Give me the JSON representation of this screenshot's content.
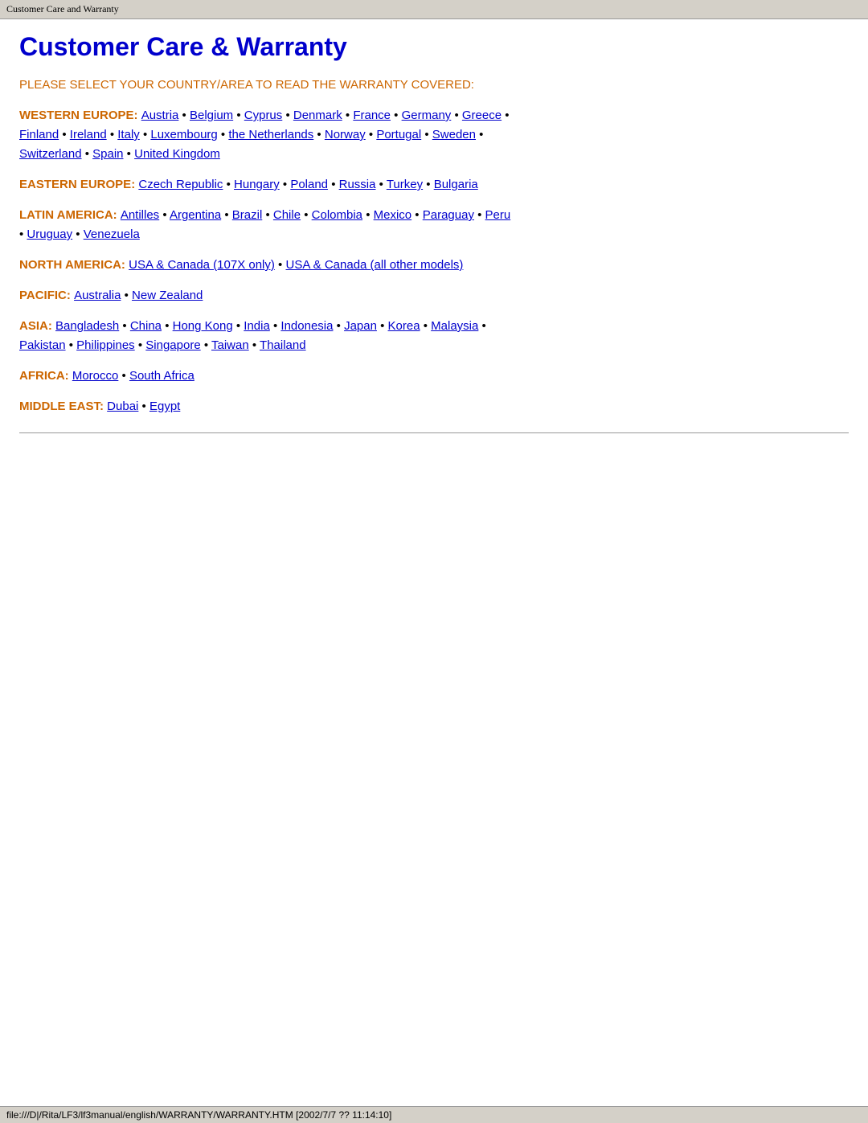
{
  "tab": {
    "title": "Customer Care and Warranty"
  },
  "page": {
    "heading": "Customer Care & Warranty",
    "instruction": "PLEASE SELECT YOUR COUNTRY/AREA TO READ THE WARRANTY COVERED:"
  },
  "regions": [
    {
      "label": "WESTERN EUROPE:",
      "countries": [
        {
          "name": "Austria",
          "href": "#"
        },
        {
          "name": "Belgium",
          "href": "#"
        },
        {
          "name": "Cyprus",
          "href": "#"
        },
        {
          "name": "Denmark",
          "href": "#"
        },
        {
          "name": "France",
          "href": "#"
        },
        {
          "name": "Germany",
          "href": "#"
        },
        {
          "name": "Greece",
          "href": "#"
        },
        {
          "name": "Finland",
          "href": "#"
        },
        {
          "name": "Ireland",
          "href": "#"
        },
        {
          "name": "Italy",
          "href": "#"
        },
        {
          "name": "Luxembourg",
          "href": "#"
        },
        {
          "name": "the Netherlands",
          "href": "#"
        },
        {
          "name": "Norway",
          "href": "#"
        },
        {
          "name": "Portugal",
          "href": "#"
        },
        {
          "name": "Sweden",
          "href": "#"
        },
        {
          "name": "Switzerland",
          "href": "#"
        },
        {
          "name": "Spain",
          "href": "#"
        },
        {
          "name": "United Kingdom",
          "href": "#"
        }
      ]
    },
    {
      "label": "EASTERN EUROPE:",
      "countries": [
        {
          "name": "Czech Republic",
          "href": "#"
        },
        {
          "name": "Hungary",
          "href": "#"
        },
        {
          "name": "Poland",
          "href": "#"
        },
        {
          "name": "Russia",
          "href": "#"
        },
        {
          "name": "Turkey",
          "href": "#"
        },
        {
          "name": "Bulgaria",
          "href": "#"
        }
      ]
    },
    {
      "label": "LATIN AMERICA:",
      "countries": [
        {
          "name": "Antilles",
          "href": "#"
        },
        {
          "name": "Argentina",
          "href": "#"
        },
        {
          "name": "Brazil",
          "href": "#"
        },
        {
          "name": "Chile",
          "href": "#"
        },
        {
          "name": "Colombia",
          "href": "#"
        },
        {
          "name": "Mexico",
          "href": "#"
        },
        {
          "name": "Paraguay",
          "href": "#"
        },
        {
          "name": "Peru",
          "href": "#"
        },
        {
          "name": "Uruguay",
          "href": "#"
        },
        {
          "name": "Venezuela",
          "href": "#"
        }
      ]
    },
    {
      "label": "NORTH AMERICA:",
      "countries": [
        {
          "name": "USA & Canada (107X only)",
          "href": "#"
        },
        {
          "name": "USA & Canada (all other models)",
          "href": "#"
        }
      ]
    },
    {
      "label": "PACIFIC:",
      "countries": [
        {
          "name": "Australia",
          "href": "#"
        },
        {
          "name": "New Zealand",
          "href": "#"
        }
      ]
    },
    {
      "label": "ASIA:",
      "countries": [
        {
          "name": "Bangladesh",
          "href": "#"
        },
        {
          "name": "China",
          "href": "#"
        },
        {
          "name": "Hong Kong",
          "href": "#"
        },
        {
          "name": "India",
          "href": "#"
        },
        {
          "name": "Indonesia",
          "href": "#"
        },
        {
          "name": "Japan",
          "href": "#"
        },
        {
          "name": "Korea",
          "href": "#"
        },
        {
          "name": "Malaysia",
          "href": "#"
        },
        {
          "name": "Pakistan",
          "href": "#"
        },
        {
          "name": "Philippines",
          "href": "#"
        },
        {
          "name": "Singapore",
          "href": "#"
        },
        {
          "name": "Taiwan",
          "href": "#"
        },
        {
          "name": "Thailand",
          "href": "#"
        }
      ]
    },
    {
      "label": "AFRICA:",
      "countries": [
        {
          "name": "Morocco",
          "href": "#"
        },
        {
          "name": "South Africa",
          "href": "#"
        }
      ]
    },
    {
      "label": "MIDDLE EAST:",
      "countries": [
        {
          "name": "Dubai",
          "href": "#"
        },
        {
          "name": "Egypt",
          "href": "#"
        }
      ]
    }
  ],
  "statusBar": {
    "text": "file:///D|/Rita/LF3/lf3manual/english/WARRANTY/WARRANTY.HTM [2002/7/7 ?? 11:14:10]"
  },
  "westernEurope": {
    "line1": [
      "Austria",
      "Belgium",
      "Cyprus",
      "Denmark",
      "France",
      "Germany",
      "Greece"
    ],
    "line2": [
      "Finland",
      "Ireland",
      "Italy",
      "Luxembourg",
      "the Netherlands",
      "Norway",
      "Portugal",
      "Sweden"
    ],
    "line3": [
      "Switzerland",
      "Spain",
      "United Kingdom"
    ]
  }
}
